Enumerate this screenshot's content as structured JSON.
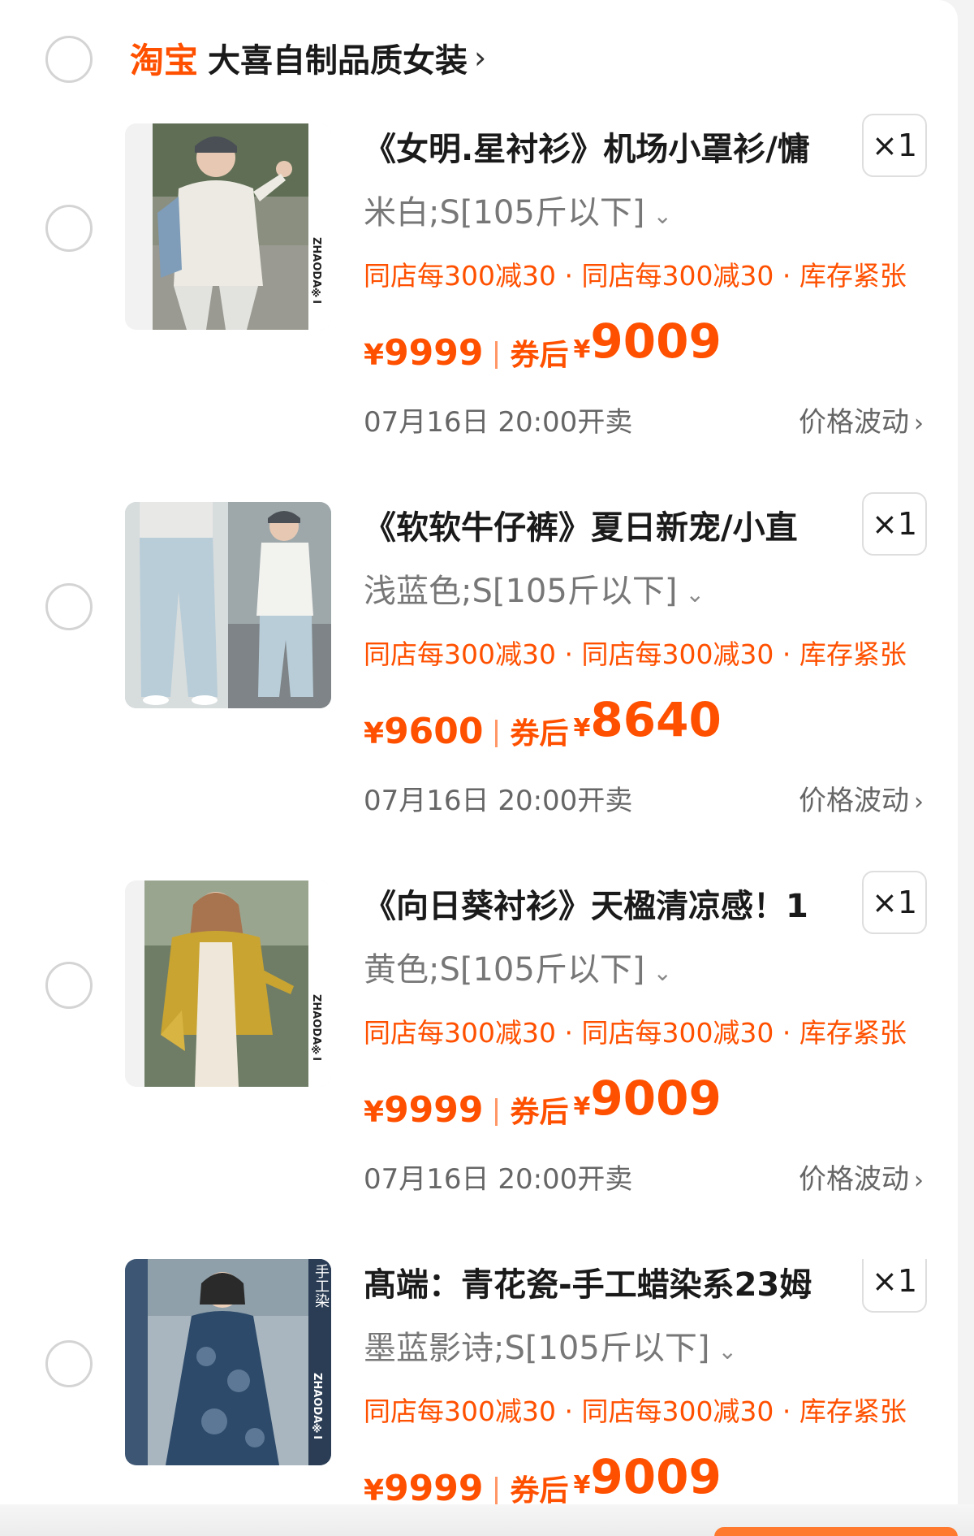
{
  "shop": {
    "logo_text": "淘宝",
    "name": "大喜自制品质女装",
    "chevron": "›"
  },
  "items": [
    {
      "title": "《女明.星衬衫》机场小罩衫/慵",
      "quantity": "×1",
      "spec": "米白;S[105斤以下]",
      "spec_chevron": "⌄",
      "promo": "同店每300减30 · 同店每300减30 · 库存紧张",
      "price_original": "9999",
      "after_coupon_label": "券后",
      "price_after": "9009",
      "currency": "¥",
      "sale_time": "07月16日 20:00开卖",
      "price_trend": "价格波动",
      "image_watermark": "ZHAODA※I"
    },
    {
      "title": "《软软牛仔裤》夏日新宠/小直",
      "quantity": "×1",
      "spec": "浅蓝色;S[105斤以下]",
      "spec_chevron": "⌄",
      "promo": "同店每300减30 · 同店每300减30 · 库存紧张",
      "price_original": "9600",
      "after_coupon_label": "券后",
      "price_after": "8640",
      "currency": "¥",
      "sale_time": "07月16日 20:00开卖",
      "price_trend": "价格波动",
      "image_watermark": ""
    },
    {
      "title": "《向日葵衬衫》天楹清凉感！1",
      "quantity": "×1",
      "spec": "黄色;S[105斤以下]",
      "spec_chevron": "⌄",
      "promo": "同店每300减30 · 同店每300减30 · 库存紧张",
      "price_original": "9999",
      "after_coupon_label": "券后",
      "price_after": "9009",
      "currency": "¥",
      "sale_time": "07月16日 20:00开卖",
      "price_trend": "价格波动",
      "image_watermark": "ZHAODA※I"
    },
    {
      "title": "髙端：青花瓷-手工蜡染系23姆",
      "quantity": "×1",
      "spec": "墨蓝影诗;S[105斤以下]",
      "spec_chevron": "⌄",
      "promo": "同店每300减30 · 同店每300减30 · 库存紧张",
      "price_original": "9999",
      "after_coupon_label": "券后",
      "price_after": "9009",
      "currency": "¥",
      "sale_time": "",
      "price_trend": "",
      "image_watermark": "ZHAODA※I",
      "image_badge": "手工染"
    }
  ],
  "icons": {
    "select_radio": "radio-unchecked-icon",
    "trend_chevron": "›"
  },
  "colors": {
    "accent": "#ff5000",
    "background": "#f3f3f3",
    "card": "#ffffff",
    "text_primary": "#1a1a1a",
    "text_secondary": "#777777"
  }
}
